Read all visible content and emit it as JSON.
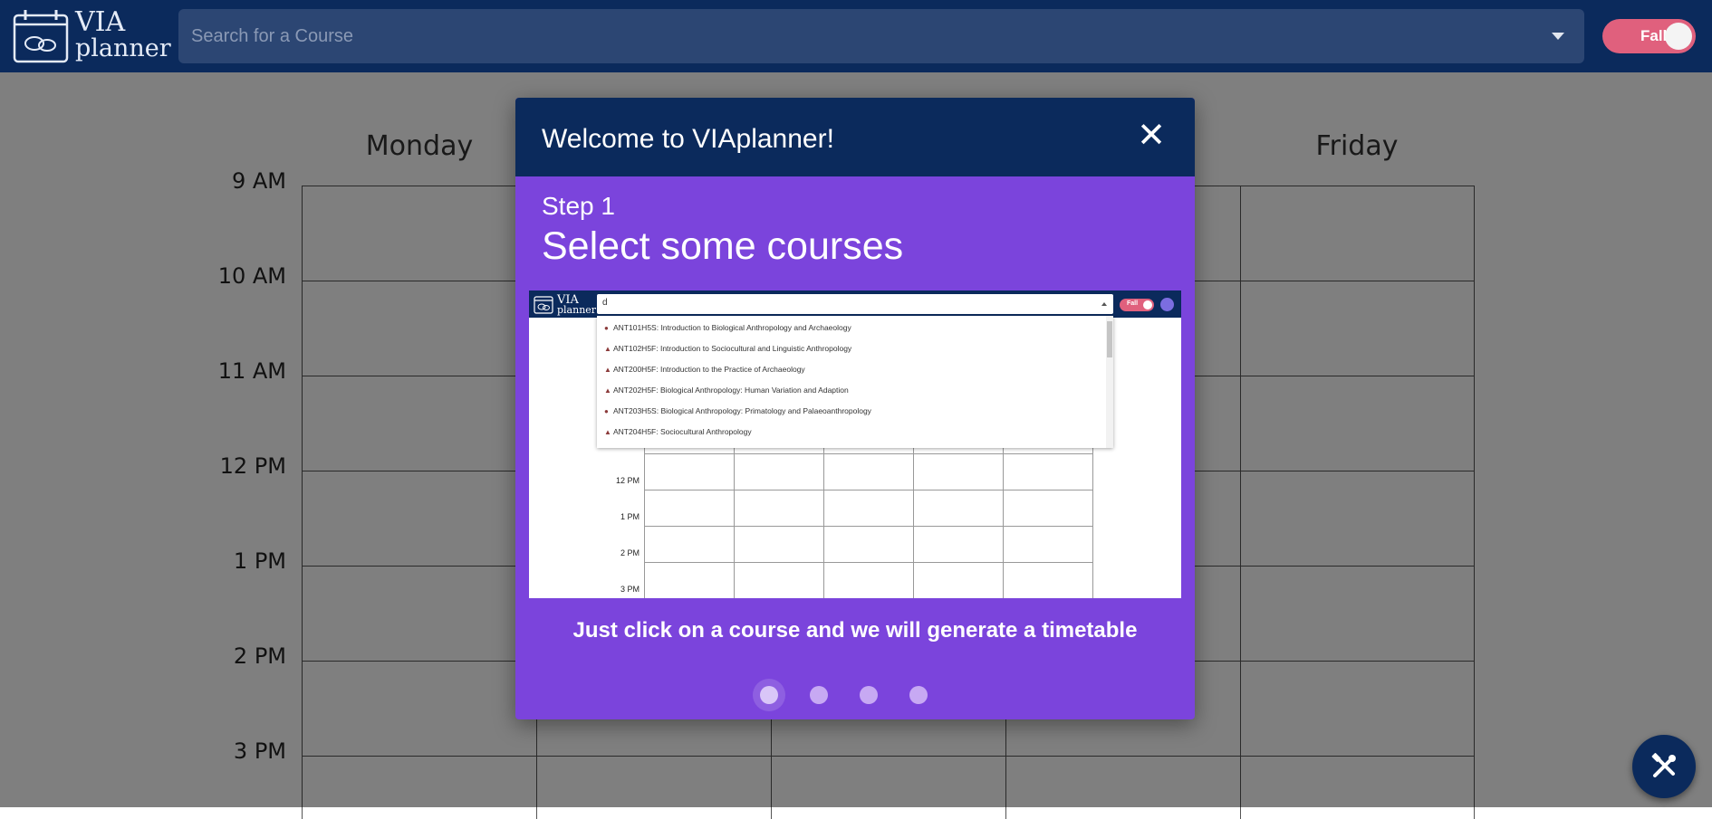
{
  "header": {
    "logo_line1": "VIA",
    "logo_line2": "planner",
    "search_placeholder": "Search for a Course",
    "term_toggle_label": "Fall"
  },
  "timetable": {
    "days_visible": [
      "Monday",
      "Friday"
    ],
    "times": [
      "9 AM",
      "10 AM",
      "11 AM",
      "12 PM",
      "1 PM",
      "2 PM",
      "3 PM"
    ]
  },
  "modal": {
    "title": "Welcome to VIAplanner!",
    "close_icon": "close-icon",
    "step_label": "Step 1",
    "heading": "Select some courses",
    "caption": "Just click on a course and we will generate a timetable",
    "total_steps": 4,
    "active_step": 1
  },
  "preview": {
    "logo_line1": "VIA",
    "logo_line2": "planner",
    "search_query": "d",
    "toggle_label": "Fall",
    "options": [
      "ANT101H5S: Introduction to Biological Anthropology and Archaeology",
      "ANT102H5F: Introduction to Sociocultural and Linguistic Anthropology",
      "ANT200H5F: Introduction to the Practice of Archaeology",
      "ANT202H5F: Biological Anthropology: Human Variation and Adaption",
      "ANT203H5S: Biological Anthropology: Primatology and Palaeoanthropology",
      "ANT204H5F: Sociocultural Anthropology"
    ],
    "times": [
      "12 PM",
      "1 PM",
      "2 PM",
      "3 PM"
    ]
  },
  "fab": {
    "icon": "tools-icon"
  },
  "colors": {
    "navy": "#0b2a5c",
    "purple": "#7b44dc",
    "toggle_pink": "#e0607d"
  }
}
